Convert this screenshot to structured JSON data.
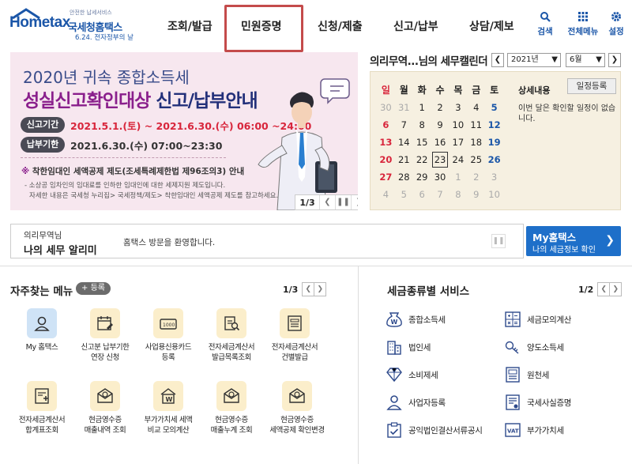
{
  "header": {
    "logo": {
      "small": "안전한 납세서비스",
      "brand_en_a": "Home",
      "brand_en_b": "tax",
      "brand_kr": "국세청홈택스",
      "tagline": "6.24. 전자정부의 날"
    },
    "nav": [
      {
        "label": "조회/발급"
      },
      {
        "label": "민원증명"
      },
      {
        "label": "신청/제출"
      },
      {
        "label": "신고/납부"
      },
      {
        "label": "상담/제보"
      }
    ],
    "utility": [
      {
        "label": "검색",
        "icon": "search-icon"
      },
      {
        "label": "전체메뉴",
        "icon": "grid-icon"
      },
      {
        "label": "설정",
        "icon": "gear-icon"
      }
    ]
  },
  "banner": {
    "line1": "2020년 귀속 종합소득세",
    "line2a": "성실신고확인대상",
    "line2b": " 신고/납부안내",
    "tag1": "신고기간",
    "period1": "2021.5.1.(토) ~ 2021.6.30.(수) 06:00 ~24:00",
    "tag2": "납부기한",
    "period2": "2021.6.30.(수) 07:00~23:30",
    "note_mark": "※",
    "note_title": " 착한임대인 세액공제 제도(조세특례제한법 제96조의3) 안내",
    "note_line1": "- 소상공 임차인의 임대료를 인하한 임대인에 대한 세제지원 제도입니다.",
    "note_line2": "자세한 내용은 국세청 누리집> 국세정책/제도> 착한임대인 세액공제 제도를 참고하세요.",
    "page": "1/3"
  },
  "calendar": {
    "title": "의리무역...님의 세무캘린더",
    "year": "2021년",
    "month": "6월",
    "weekdays": [
      "일",
      "월",
      "화",
      "수",
      "목",
      "금",
      "토"
    ],
    "weeks": [
      [
        "30",
        "31",
        "1",
        "2",
        "3",
        "4",
        "5"
      ],
      [
        "6",
        "7",
        "8",
        "9",
        "10",
        "11",
        "12"
      ],
      [
        "13",
        "14",
        "15",
        "16",
        "17",
        "18",
        "19"
      ],
      [
        "20",
        "21",
        "22",
        "23",
        "24",
        "25",
        "26"
      ],
      [
        "27",
        "28",
        "29",
        "30",
        "1",
        "2",
        "3"
      ],
      [
        "4",
        "5",
        "6",
        "7",
        "8",
        "9",
        "10"
      ]
    ],
    "detail_title": "상세내용",
    "register_label": "일정등록",
    "message": "이번 달은 확인할 일정이 없습니다."
  },
  "alarm": {
    "user": "의리무역님",
    "title": "나의 세무 알리미",
    "message": "홈택스 방문을 환영합니다.",
    "myhome_title": "My홈택스",
    "myhome_sub": "나의 세금정보 확인"
  },
  "frequent": {
    "title": "자주찾는 메뉴",
    "register": "+ 등록",
    "page": "1/3",
    "items": [
      {
        "label": "My 홈택스",
        "icon": "person-icon"
      },
      {
        "label": "신고분 납부기한\n연장 신청",
        "icon": "calendar-edit-icon"
      },
      {
        "label": "사업용신용카드\n등록",
        "icon": "card-icon"
      },
      {
        "label": "전자세금계산서\n발급목록조회",
        "icon": "invoice-search-icon"
      },
      {
        "label": "전자세금계산서\n건별발급",
        "icon": "invoice-icon"
      },
      {
        "label": "전자세금계산서\n합계표조회",
        "icon": "invoice-sum-icon"
      },
      {
        "label": "현금영수증\n매출내역 조회",
        "icon": "receipt-icon"
      },
      {
        "label": "부가가치세 세액\n비교 모의계산",
        "icon": "vat-calc-icon"
      },
      {
        "label": "현금영수증\n매출누계 조회",
        "icon": "receipt-total-icon"
      },
      {
        "label": "현금영수증\n세액공제 확인변경",
        "icon": "receipt-deduct-icon"
      }
    ]
  },
  "services": {
    "title": "세금종류별 서비스",
    "page": "1/2",
    "items": [
      {
        "label": "종합소득세",
        "icon": "won-bag-icon"
      },
      {
        "label": "세금모의계산",
        "icon": "calculator-icon"
      },
      {
        "label": "법인세",
        "icon": "building-icon"
      },
      {
        "label": "양도소득세",
        "icon": "key-icon"
      },
      {
        "label": "소비제세",
        "icon": "diamond-icon"
      },
      {
        "label": "원천세",
        "icon": "ledger-icon"
      },
      {
        "label": "사업자등록",
        "icon": "person-icon"
      },
      {
        "label": "국세사실증명",
        "icon": "certificate-icon"
      },
      {
        "label": "공익법인결산서류공시",
        "icon": "clipboard-icon"
      },
      {
        "label": "부가가치세",
        "icon": "vat-icon"
      }
    ]
  }
}
